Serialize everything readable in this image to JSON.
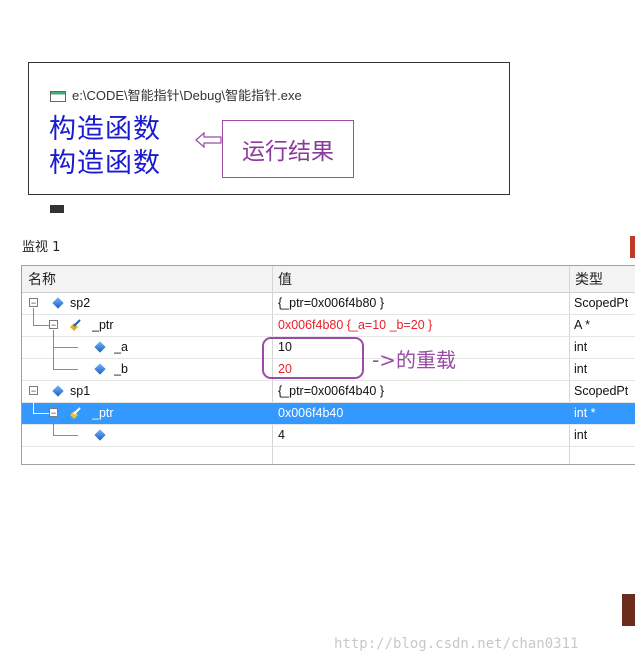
{
  "console": {
    "title": "e:\\CODE\\智能指针\\Debug\\智能指针.exe",
    "lines": [
      "构造函数",
      "构造函数"
    ],
    "annotation": "运行结果"
  },
  "watch": {
    "title": "监视 1",
    "columns": [
      "名称",
      "值",
      "类型"
    ],
    "rows": [
      {
        "name": "sp2",
        "value": "{_ptr=0x006f4b80 }",
        "type": "ScopedPt"
      },
      {
        "name": "_ptr",
        "value": "0x006f4b80 {_a=10 _b=20 }",
        "type": "A *"
      },
      {
        "name": "_a",
        "value": "10",
        "type": "int"
      },
      {
        "name": "_b",
        "value": "20",
        "type": "int"
      },
      {
        "name": "sp1",
        "value": "{_ptr=0x006f4b40 }",
        "type": "ScopedPt"
      },
      {
        "name": "_ptr",
        "value": "0x006f4b40",
        "type": "int *"
      },
      {
        "name": "",
        "value": "4",
        "type": "int"
      }
    ],
    "callout": "->的重载"
  },
  "watermark": "http://blog.csdn.net/chan0311",
  "colors": {
    "selection": "#3399ff",
    "changed_value": "#e8212a",
    "annotation": "#9b4aa8",
    "console_text": "#1a1acf"
  }
}
